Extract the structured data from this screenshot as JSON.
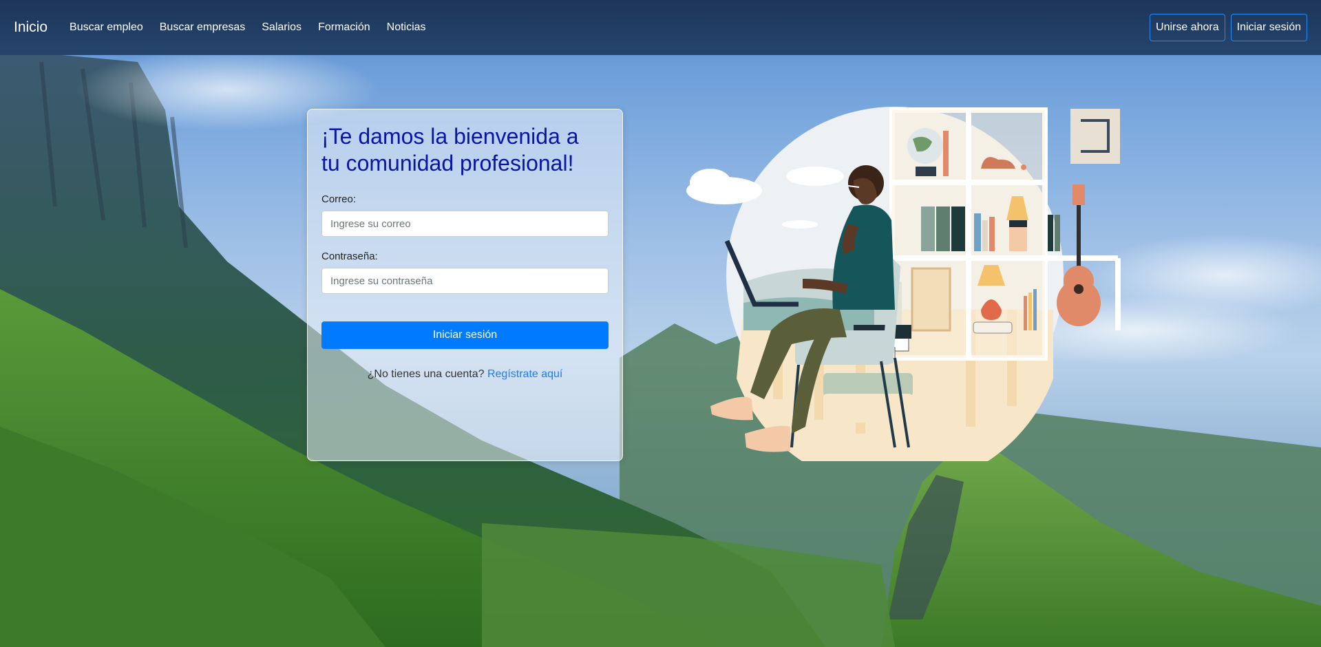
{
  "navbar": {
    "brand": "Inicio",
    "links": [
      {
        "label": "Buscar empleo"
      },
      {
        "label": "Buscar empresas"
      },
      {
        "label": "Salarios"
      },
      {
        "label": "Formación"
      },
      {
        "label": "Noticias"
      }
    ],
    "join_label": "Unirse ahora",
    "login_label": "Iniciar sesión"
  },
  "login_card": {
    "heading": "¡Te damos la bienvenida a tu comunidad profesional!",
    "email_label": "Correo:",
    "email_placeholder": "Ingrese su correo",
    "email_value": "",
    "password_label": "Contraseña:",
    "password_placeholder": "Ingrese su contraseña",
    "password_value": "",
    "submit_label": "Iniciar sesión",
    "signup_prompt": "¿No tienes una cuenta?",
    "signup_link": "Regístrate aquí"
  },
  "colors": {
    "navbar_bg": "#1d3557",
    "heading": "#0a14a8",
    "primary": "#007bff",
    "link": "#1a7cff"
  },
  "icons": {
    "illustration": "person-working-on-laptop-illustration",
    "background": "mountain-landscape"
  }
}
